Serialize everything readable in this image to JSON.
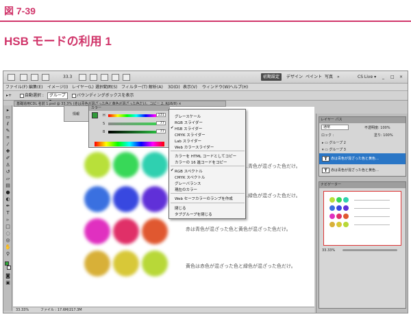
{
  "figure": {
    "label": "図 7-39",
    "heading": "HSB モードの利用 1"
  },
  "app": {
    "zoom_menu": "33.3",
    "workspaces": [
      "初期設定",
      "デザイン",
      "ペイント",
      "写真",
      "»"
    ],
    "cslive": "CS Live ▾",
    "menus": [
      "ファイル(F)",
      "編集(E)",
      "イメージ(I)",
      "レイヤー(L)",
      "選択範囲(S)",
      "フィルター(T)",
      "解析(A)",
      "3D(D)",
      "表示(V)",
      "ウィンドウ(W)",
      "ヘルプ(H)"
    ],
    "options": {
      "auto_select": "自動選択 :",
      "group": "グループ ▾",
      "bbox": "バウンディングボックスを表示"
    }
  },
  "document": {
    "tab": "基礎追用CDL 名前 1.psd @ 33.3% (赤は青色が混ざった色と黄色が混ざった色だけ。コピー 2, RGB/8) ×",
    "captions": [
      "…青色が混ざった色だけ。",
      "…緑色が混ざった色だけ。",
      "赤は青色が混ざった色と黄色が混ざった色だけ。",
      "黄色は赤色が混ざった色と緑色が混ざった色だけ。"
    ],
    "status_zoom": "33.33%",
    "status_file": "ファイル : 17.6M/217.3M"
  },
  "circles": [
    [
      "#b8e03a",
      "#38d858",
      "#2fd0b0"
    ],
    [
      "#3a70e0",
      "#3848e0",
      "#6030d8"
    ],
    [
      "#e030c0",
      "#e03068",
      "#e05830"
    ],
    [
      "#d8b038",
      "#d8c838",
      "#b8d838"
    ]
  ],
  "color_panel": {
    "title": "カラー",
    "h_label": "H",
    "h_value": "131",
    "s_label": "S",
    "s_value": "77",
    "b_label": "B",
    "b_value": "77",
    "extra": "情報"
  },
  "flyout": {
    "items": [
      {
        "label": "グレースケール",
        "checked": false
      },
      {
        "label": "RGB スライダー",
        "checked": false
      },
      {
        "label": "HSB スライダー",
        "checked": true
      },
      {
        "label": "CMYK スライダー",
        "checked": false
      },
      {
        "label": "Lab スライダー",
        "checked": false
      },
      {
        "label": "Web カラースライダー",
        "checked": false
      },
      {
        "label": "カラーを HTML コードとしてコピー",
        "checked": false
      },
      {
        "label": "カラーの 16 進コードをコピー",
        "checked": false
      },
      {
        "label": "RGB スペクトル",
        "checked": true
      },
      {
        "label": "CMYK スペクトル",
        "checked": false
      },
      {
        "label": "グレーバランス",
        "checked": false
      },
      {
        "label": "現在のカラー",
        "checked": false
      },
      {
        "label": "Web セーフカラーのランプを作成",
        "checked": false
      },
      {
        "label": "閉じる",
        "checked": false
      },
      {
        "label": "タブグループを閉じる",
        "checked": false
      }
    ]
  },
  "layers": {
    "tabs": "レイヤー  パス",
    "blend": "通常",
    "opacity": "不透明度: 100%",
    "lock": "ロック :",
    "fill": "塗り: 100%",
    "rows": [
      "グループ 2",
      "グループ 3",
      "赤は青色が混ざった色と黄色…",
      "赤は青色が混ざった色と黄色…"
    ]
  },
  "navigator": {
    "title": "ナビゲーター",
    "zoom": "33.33%"
  },
  "accent": "#d0356a"
}
